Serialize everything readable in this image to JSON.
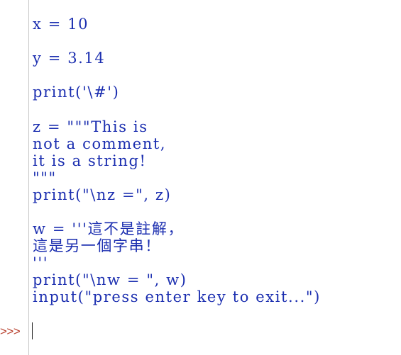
{
  "editor": {
    "lines": [
      "x = 10",
      "y = 3.14",
      "print('\\#')",
      "z = \"\"\"This is",
      "not a comment,",
      "it is a string!",
      "\"\"\"",
      "print(\"\\nz =\", z)",
      "w = '''這不是註解，",
      "這是另一個字串！",
      "'''",
      "print(\"\\nw = \", w)",
      "input(\"press enter key to exit...\")"
    ]
  },
  "shell": {
    "prompt": ">>>"
  },
  "colors": {
    "code": "#1c2fb0",
    "prompt": "#b8402e",
    "gutter": "#c8c8c8"
  }
}
